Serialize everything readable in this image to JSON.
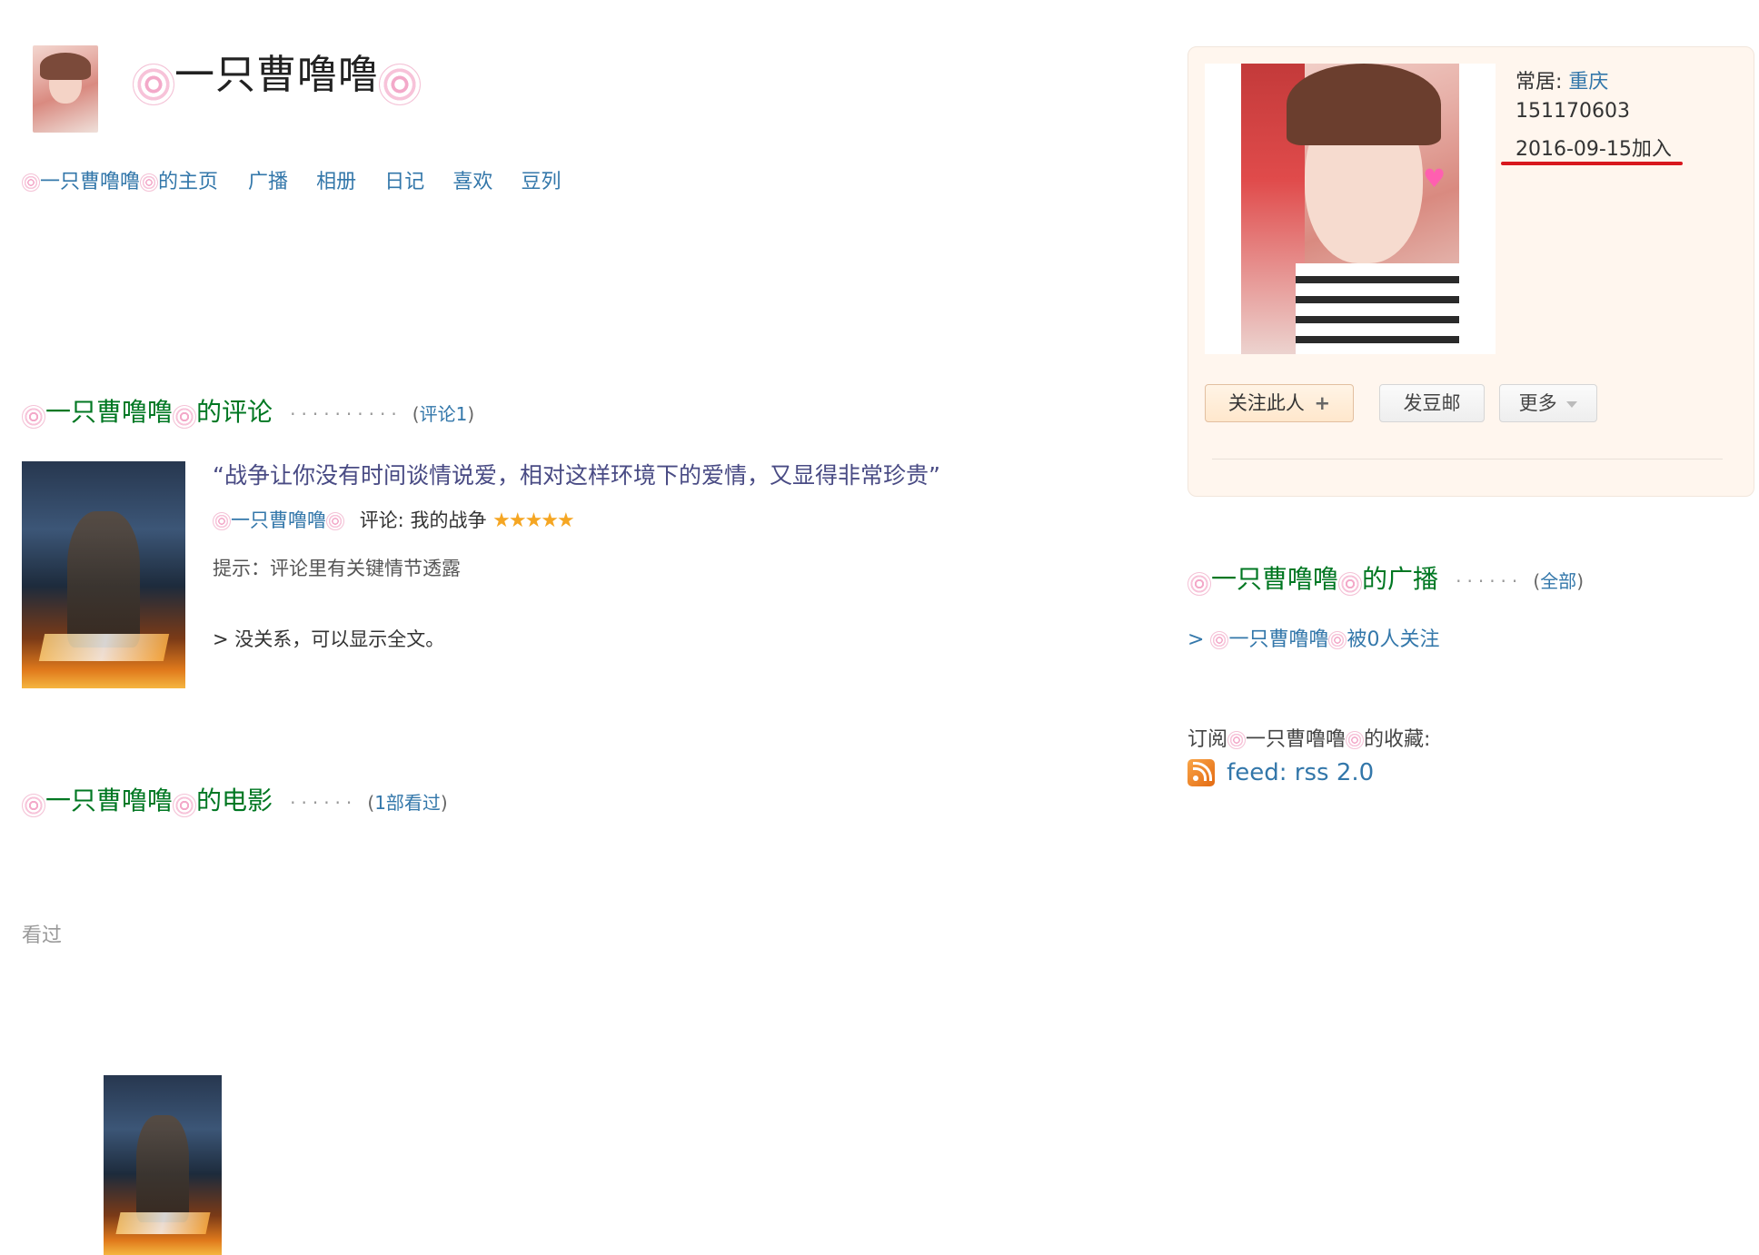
{
  "profile": {
    "name": "一只曹噜噜",
    "location_label": "常居:",
    "location_value": "重庆",
    "user_id": "151170603",
    "joined": "2016-09-15加入"
  },
  "nav": {
    "items": [
      "的主页",
      "广播",
      "相册",
      "日记",
      "喜欢",
      "豆列"
    ]
  },
  "actions": {
    "follow": "关注此人",
    "follow_icon": "+",
    "message": "发豆邮",
    "more": "更多"
  },
  "reviews": {
    "title_suffix": "的评论",
    "count_prefix": "(",
    "count_link": "评论1",
    "count_suffix": ")",
    "quote": "“战争让你没有时间谈情说爱，相对这样环境下的爱情，又显得非常珍贵”",
    "review_label": "评论: 我的战争",
    "rating_stars": 5,
    "spoiler": "提示：评论里有关键情节透露",
    "show_all_prefix": ">",
    "show_all": "没关系，可以显示全文。"
  },
  "movies": {
    "title_suffix": "的电影",
    "count_prefix": "(",
    "count_link": "1部看过",
    "count_suffix": ")",
    "watched_label": "看过"
  },
  "broadcast": {
    "title_suffix": "的广播",
    "count_prefix": "(",
    "count_link": "全部",
    "count_suffix": ")",
    "followers_prefix": ">",
    "followers_text": "被0人关注"
  },
  "subscribe": {
    "prefix": "订阅",
    "suffix": "的收藏:",
    "feed": "feed: rss 2.0"
  },
  "colors": {
    "link": "#3377aa",
    "section_title": "#007722",
    "underline": "#d8181e",
    "star": "#f5a623"
  }
}
